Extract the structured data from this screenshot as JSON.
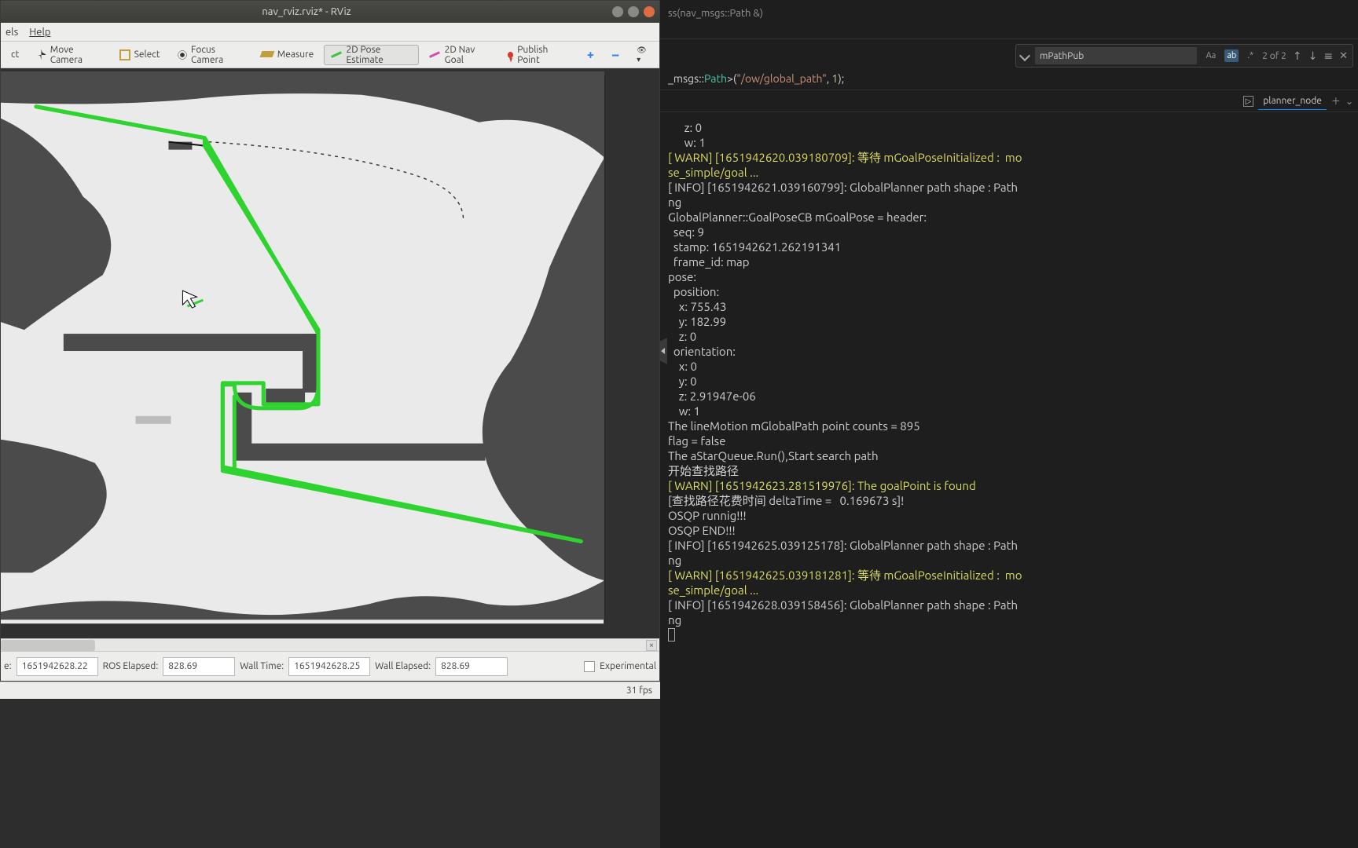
{
  "rviz": {
    "title": "nav_rviz.rviz* - RViz",
    "menu": {
      "els": "els",
      "help": "Help"
    },
    "toolbar": {
      "ct": "ct",
      "move_camera": "Move Camera",
      "select": "Select",
      "focus_camera": "Focus Camera",
      "measure": "Measure",
      "pose_estimate": "2D Pose Estimate",
      "nav_goal": "2D Nav Goal",
      "publish_point": "Publish Point"
    },
    "status": {
      "e_label": "e:",
      "e_value": "1651942628.22",
      "ros_elapsed_label": "ROS Elapsed:",
      "ros_elapsed_value": "828.69",
      "wall_time_label": "Wall Time:",
      "wall_time_value": "1651942628.25",
      "wall_elapsed_label": "Wall Elapsed:",
      "wall_elapsed_value": "828.69",
      "experimental_label": "Experimental"
    },
    "fps": "31 fps",
    "map_close": "×"
  },
  "vscode": {
    "breadcrumb": "ss(nav_msgs::Path &)",
    "find": {
      "query": "mPathPub",
      "opt_case": "Aa",
      "opt_word": "ab",
      "opt_regex": ".*",
      "count": "2 of 2"
    },
    "code_snippet": {
      "prefix": "_msgs::",
      "type": "Path",
      "op": ">(",
      "str": "\"/ow/global_path\"",
      "mid": ", ",
      "num": "1",
      "suffix": ");"
    },
    "terminal_tab": "planner_node",
    "logs": [
      {
        "cls": "log-info",
        "text": "      z: 0"
      },
      {
        "cls": "log-info",
        "text": "      w: 1"
      },
      {
        "cls": "log-info",
        "text": ""
      },
      {
        "cls": "log-warn",
        "text": "[ WARN] [1651942620.039180709]: 等待 mGoalPoseInitialized :  mo"
      },
      {
        "cls": "log-warn",
        "text": "se_simple/goal ..."
      },
      {
        "cls": "log-info",
        "text": "[ INFO] [1651942621.039160799]: GlobalPlanner path shape : Path"
      },
      {
        "cls": "log-info",
        "text": "ng"
      },
      {
        "cls": "log-info",
        "text": "GlobalPlanner::GoalPoseCB mGoalPose = header: "
      },
      {
        "cls": "log-info",
        "text": "  seq: 9"
      },
      {
        "cls": "log-info",
        "text": "  stamp: 1651942621.262191341"
      },
      {
        "cls": "log-info",
        "text": "  frame_id: map"
      },
      {
        "cls": "log-info",
        "text": "pose: "
      },
      {
        "cls": "log-info",
        "text": "  position: "
      },
      {
        "cls": "log-info",
        "text": "    x: 755.43"
      },
      {
        "cls": "log-info",
        "text": "    y: 182.99"
      },
      {
        "cls": "log-info",
        "text": "    z: 0"
      },
      {
        "cls": "log-info",
        "text": "  orientation: "
      },
      {
        "cls": "log-info",
        "text": "    x: 0"
      },
      {
        "cls": "log-info",
        "text": "    y: 0"
      },
      {
        "cls": "log-info",
        "text": "    z: 2.91947e-06"
      },
      {
        "cls": "log-info",
        "text": "    w: 1"
      },
      {
        "cls": "log-info",
        "text": ""
      },
      {
        "cls": "log-info",
        "text": "The lineMotion mGlobalPath point counts = 895"
      },
      {
        "cls": "log-info",
        "text": "flag = false"
      },
      {
        "cls": "log-info",
        "text": "The aStarQueue.Run(),Start search path"
      },
      {
        "cls": "log-info",
        "text": "开始查找路径"
      },
      {
        "cls": "log-warn",
        "text": "[ WARN] [1651942623.281519976]: The goalPoint is found"
      },
      {
        "cls": "log-info",
        "text": "[查找路径花费时间 deltaTime =   0.169673 s]!"
      },
      {
        "cls": "log-info",
        "text": "OSQP runnig!!!"
      },
      {
        "cls": "log-info",
        "text": "OSQP END!!!"
      },
      {
        "cls": "log-info",
        "text": "[ INFO] [1651942625.039125178]: GlobalPlanner path shape : Path"
      },
      {
        "cls": "log-info",
        "text": "ng"
      },
      {
        "cls": "log-warn",
        "text": "[ WARN] [1651942625.039181281]: 等待 mGoalPoseInitialized :  mo"
      },
      {
        "cls": "log-warn",
        "text": "se_simple/goal ..."
      },
      {
        "cls": "log-info",
        "text": "[ INFO] [1651942628.039158456]: GlobalPlanner path shape : Path"
      },
      {
        "cls": "log-info",
        "text": "ng"
      }
    ]
  }
}
